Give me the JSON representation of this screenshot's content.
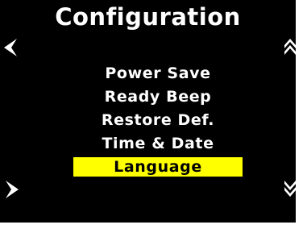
{
  "screen": {
    "title": "Configuration",
    "menu": [
      {
        "label": "Power Save",
        "selected": false
      },
      {
        "label": "Ready Beep",
        "selected": false
      },
      {
        "label": "Restore Def.",
        "selected": false
      },
      {
        "label": "Time & Date",
        "selected": false
      },
      {
        "label": "Language",
        "selected": true
      }
    ],
    "icons": {
      "left": "chevron-left-icon",
      "right": "chevron-right-icon",
      "up": "double-chevron-up-icon",
      "down": "double-chevron-down-icon"
    },
    "colors": {
      "background": "#000000",
      "text": "#ffffff",
      "highlight": "#ffff00",
      "highlight_text": "#000000"
    }
  }
}
